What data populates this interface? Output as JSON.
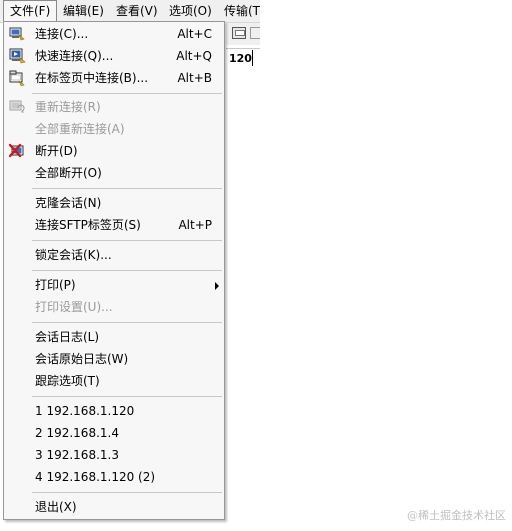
{
  "menubar": {
    "items": [
      {
        "label": "文件(F)"
      },
      {
        "label": "编辑(E)"
      },
      {
        "label": "查看(V)"
      },
      {
        "label": "选项(O)"
      },
      {
        "label": "传输(T)"
      }
    ]
  },
  "background": {
    "tab_text": "120"
  },
  "file_menu": {
    "connect": {
      "label": "连接(C)...",
      "accel": "Alt+C",
      "icon": "connect-icon"
    },
    "quick_connect": {
      "label": "快速连接(Q)...",
      "accel": "Alt+Q",
      "icon": "quick-connect-icon"
    },
    "connect_in_tab": {
      "label": "在标签页中连接(B)...",
      "accel": "Alt+B",
      "icon": "connect-in-tab-icon"
    },
    "reconnect": {
      "label": "重新连接(R)",
      "icon": "reconnect-icon"
    },
    "reconnect_all": {
      "label": "全部重新连接(A)"
    },
    "disconnect": {
      "label": "断开(D)",
      "icon": "disconnect-icon"
    },
    "disconnect_all": {
      "label": "全部断开(O)"
    },
    "clone_session": {
      "label": "克隆会话(N)"
    },
    "connect_sftp_tab": {
      "label": "连接SFTP标签页(S)",
      "accel": "Alt+P"
    },
    "lock_session": {
      "label": "锁定会话(K)..."
    },
    "print": {
      "label": "打印(P)"
    },
    "print_setup": {
      "label": "打印设置(U)..."
    },
    "session_log": {
      "label": "会话日志(L)"
    },
    "raw_session_log": {
      "label": "会话原始日志(W)"
    },
    "trace_options": {
      "label": "跟踪选项(T)"
    },
    "recent": [
      {
        "label": "1 192.168.1.120"
      },
      {
        "label": "2 192.168.1.4"
      },
      {
        "label": "3 192.168.1.3"
      },
      {
        "label": "4 192.168.1.120 (2)"
      }
    ],
    "exit": {
      "label": "退出(X)"
    }
  },
  "watermark": "@稀土掘金技术社区",
  "colors": {
    "menu_bg": "#f7f7f7",
    "menu_border": "#979797",
    "disabled_text": "#9a9a9a",
    "separator": "#c8c8c8"
  }
}
